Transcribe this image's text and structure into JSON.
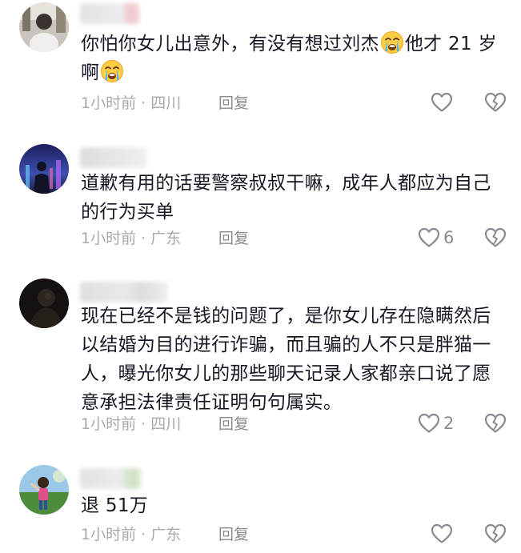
{
  "colors": {
    "text": "#161823",
    "meta": "#a8a8ad",
    "reply": "#8a8b91",
    "icon_stroke": "#8a8b91"
  },
  "comments": [
    {
      "text_before_emoji": "你怕你女儿出意外，有没有想过刘杰",
      "emoji_icon": "crying-face-icon",
      "text_after_emoji": "他才 21 岁啊",
      "meta": "1小时前 · 四川",
      "reply_label": "回复",
      "like_count": ""
    },
    {
      "text": "道歉有用的话要警察叔叔干嘛，成年人都应为自己的行为买单",
      "meta": "1小时前 · 广东",
      "reply_label": "回复",
      "like_count": "6"
    },
    {
      "text": "现在已经不是钱的问题了，是你女儿存在隐瞒然后以结婚为目的进行诈骗，而且骗的人不只是胖猫一人，曝光你女儿的那些聊天记录人家都亲口说了愿意承担法律责任证明句句属实。",
      "meta": "1小时前 · 四川",
      "reply_label": "回复",
      "like_count": "2"
    },
    {
      "text": "退 51万",
      "meta": "1小时前 · 广东",
      "reply_label": "回复",
      "like_count": ""
    }
  ]
}
